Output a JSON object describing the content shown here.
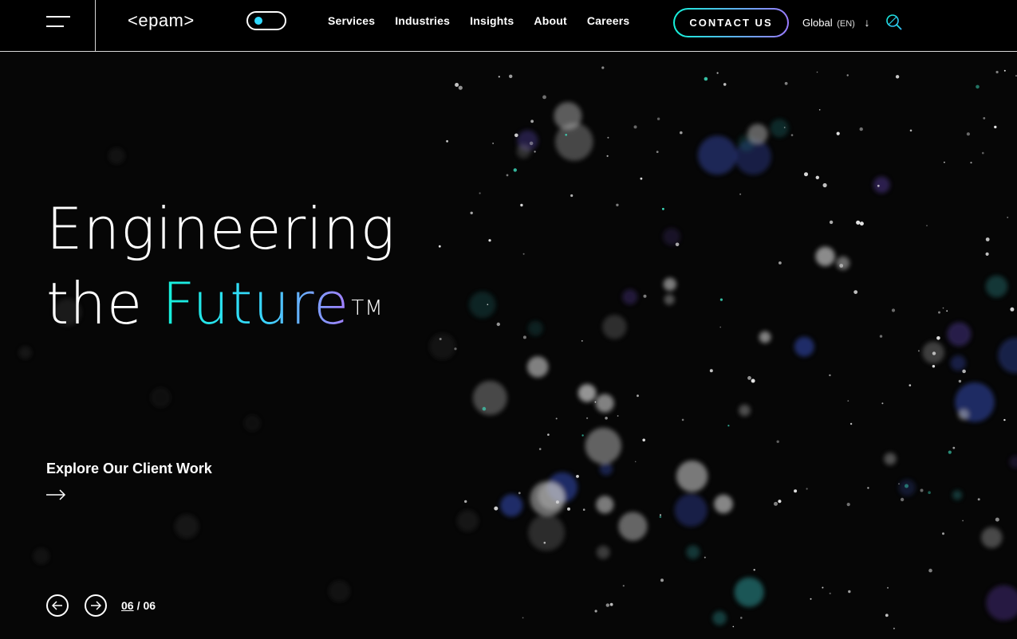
{
  "header": {
    "logo_text": "<epam>",
    "nav": [
      "Services",
      "Industries",
      "Insights",
      "About",
      "Careers"
    ],
    "contact_label": "CONTACT US",
    "lang_region": "Global",
    "lang_code": "(EN)"
  },
  "hero": {
    "title_line1": "Engineering",
    "title_line2_prefix": "the ",
    "title_accent": "Future",
    "trademark": "TM",
    "cta_label": "Explore Our Client Work"
  },
  "slider": {
    "current": "06",
    "separator": "/",
    "total": "06"
  },
  "colors": {
    "accent_start": "#14f1d9",
    "accent_end": "#a67cff",
    "toggle_knob": "#2fd9ff",
    "background": "#060606"
  },
  "icons": [
    "menu-icon",
    "theme-toggle",
    "arrow-down-icon",
    "search-icon",
    "arrow-right-icon",
    "arrow-left-icon"
  ]
}
